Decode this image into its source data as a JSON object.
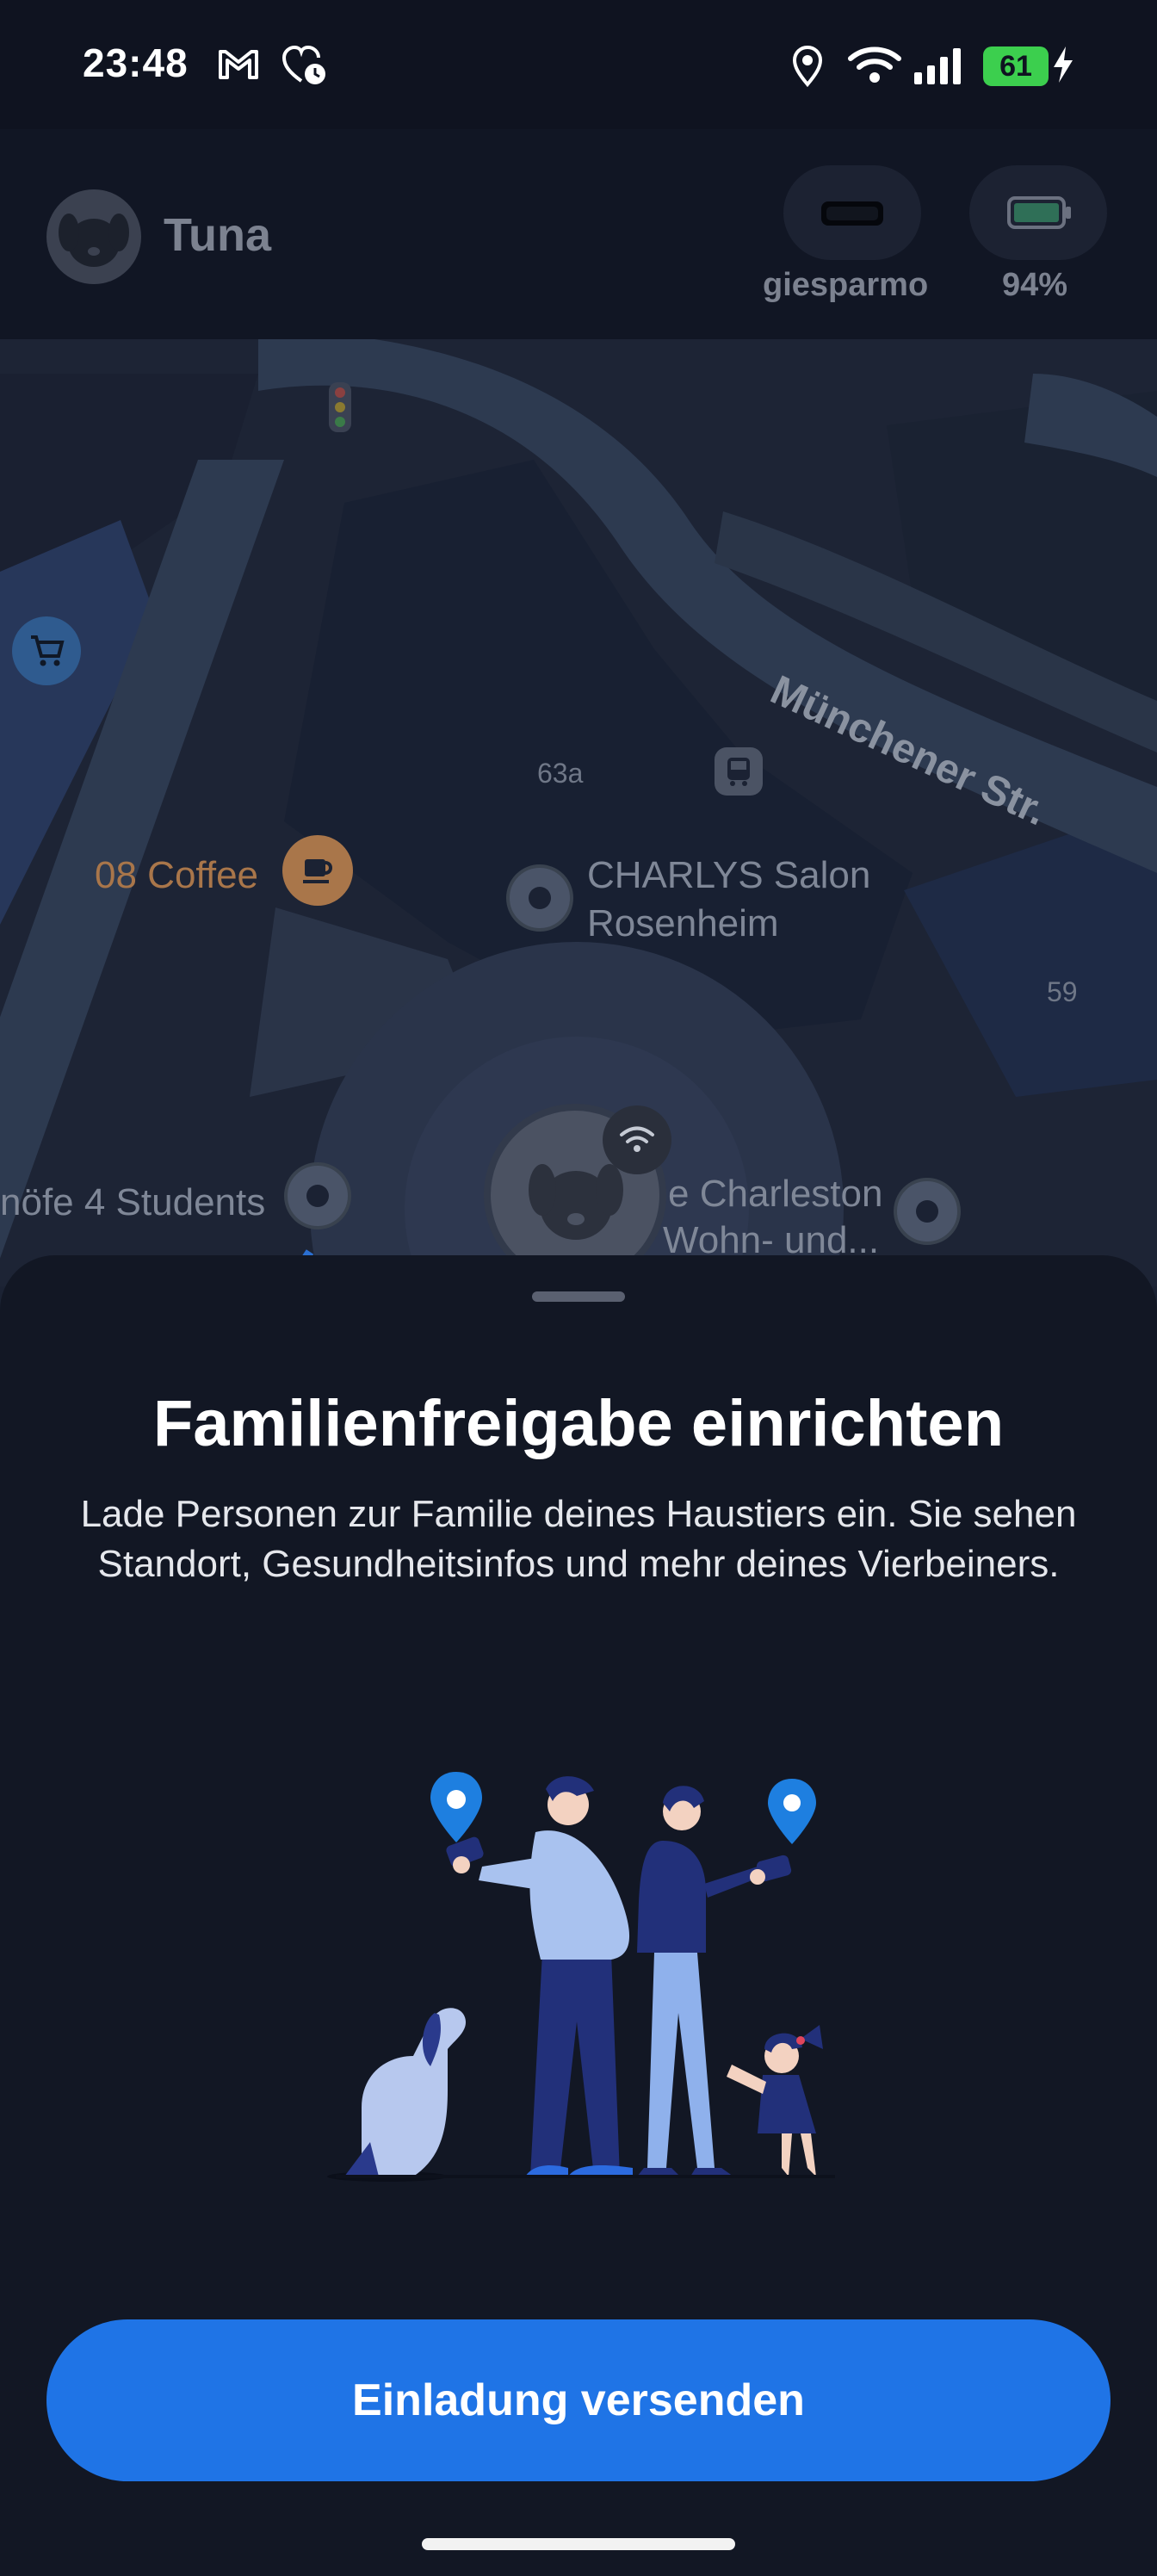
{
  "status_bar": {
    "time": "23:48",
    "battery_level": "61",
    "icons": [
      "gmail-icon",
      "health-icon",
      "location-icon",
      "wifi-icon",
      "signal-icon",
      "battery-icon",
      "charging-icon"
    ]
  },
  "header": {
    "pet_name": "Tuna",
    "mode_label": "giesparmo",
    "battery_label": "94%"
  },
  "map": {
    "street_name": "Münchener Str.",
    "house_number_1": "63a",
    "house_number_2": "59",
    "poi_coffee": "08 Coffee",
    "poi_salon_line1": "CHARLYS Salon",
    "poi_salon_line2": "Rosenheim",
    "poi_students": "nöfe 4 Students",
    "poi_charleston_line1": "e Charleston",
    "poi_charleston_line2": "Wohn- und..."
  },
  "sheet": {
    "title": "Familienfreigabe einrichten",
    "description": "Lade Personen zur Familie deines Haustiers ein. Sie sehen Standort, Gesundheitsinfos und mehr deines Vierbeiners.",
    "cta_label": "Einladung versenden"
  },
  "colors": {
    "accent": "#1f74e6",
    "background": "#121724",
    "battery_green": "#3ccf4e"
  }
}
